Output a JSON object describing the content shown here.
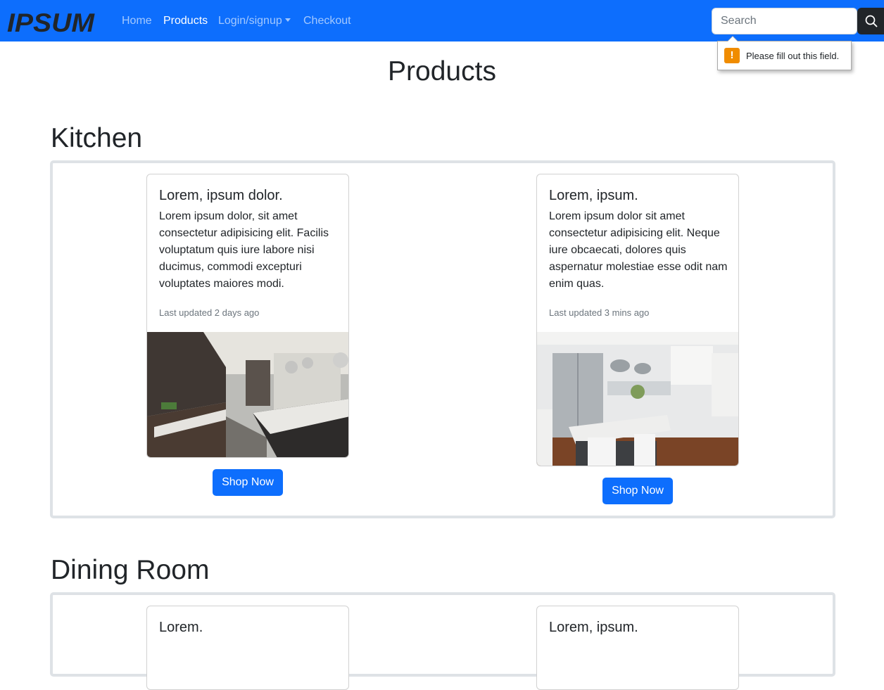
{
  "navbar": {
    "brand": "IPSUM",
    "links": [
      {
        "label": "Home"
      },
      {
        "label": "Products"
      },
      {
        "label": "Login/signup"
      },
      {
        "label": "Checkout"
      }
    ],
    "active": "Products",
    "search_placeholder": "Search",
    "search_icon": "magnifier-icon"
  },
  "validation_tooltip": {
    "icon": "warning-icon",
    "icon_glyph": "!",
    "message": "Please fill out this field."
  },
  "page_title": "Products",
  "sections": [
    {
      "title": "Kitchen",
      "products": [
        {
          "title": "Lorem, ipsum dolor.",
          "text": "Lorem ipsum dolor, sit amet consectetur adipisicing elit. Facilis voluptatum quis iure labore nisi ducimus, commodi excepturi voluptates maiores modi.",
          "updated": "Last updated 2 days ago",
          "button": "Shop Now",
          "image": "dark-kitchen-photo"
        },
        {
          "title": "Lorem, ipsum.",
          "text": "Lorem ipsum dolor sit amet consectetur adipisicing elit. Neque iure obcaecati, dolores quis aspernatur molestiae esse odit nam enim quas.",
          "updated": "Last updated 3 mins ago",
          "button": "Shop Now",
          "image": "white-kitchen-photo"
        }
      ]
    },
    {
      "title": "Dining Room",
      "products": [
        {
          "title": "Lorem."
        },
        {
          "title": "Lorem, ipsum."
        }
      ]
    }
  ],
  "colors": {
    "primary": "#0d6efd",
    "dark": "#212529",
    "muted": "#6c757d",
    "frame_border": "#dee2e6",
    "warning": "#f08c00"
  }
}
